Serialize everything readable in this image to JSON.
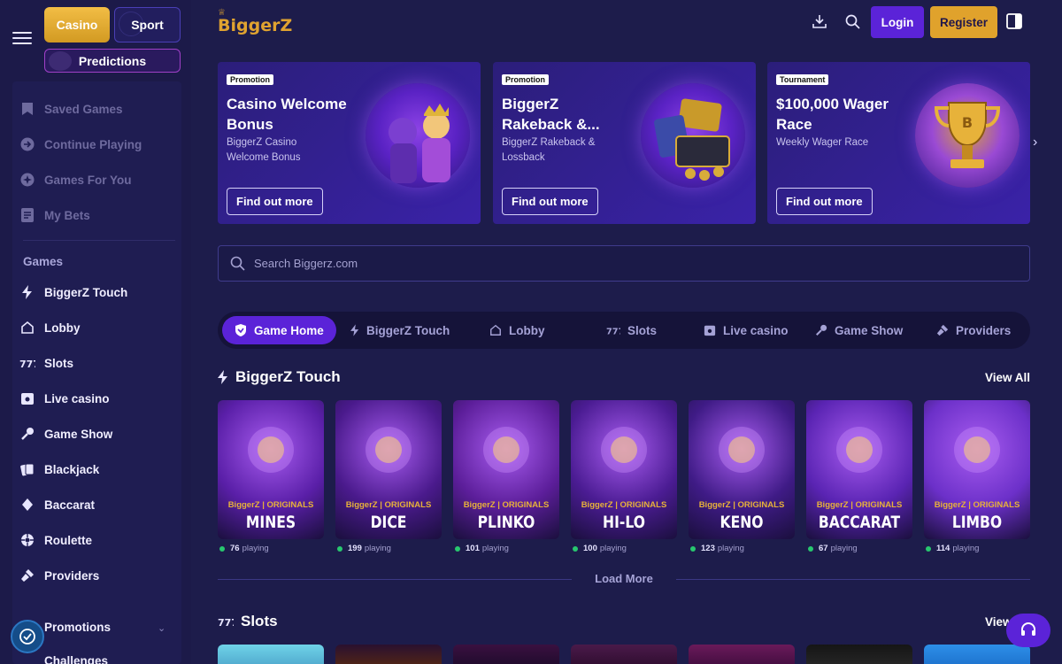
{
  "colors": {
    "accent_purple": "#5b23d8",
    "accent_gold": "#e0a22c",
    "bg": "#1d1c4b",
    "online": "#28c76f"
  },
  "sidebar": {
    "top_buttons": {
      "casino": "Casino",
      "sport": "Sport",
      "predictions": "Predictions"
    },
    "quick": [
      {
        "label": "Saved Games",
        "icon": "bookmark-icon"
      },
      {
        "label": "Continue Playing",
        "icon": "play-circle-icon"
      },
      {
        "label": "Games For You",
        "icon": "sparkle-icon"
      },
      {
        "label": "My Bets",
        "icon": "receipt-icon"
      }
    ],
    "games_header": "Games",
    "games": [
      {
        "label": "BiggerZ Touch",
        "icon": "lightning-icon"
      },
      {
        "label": "Lobby",
        "icon": "home-icon"
      },
      {
        "label": "Slots",
        "icon": "slots-icon"
      },
      {
        "label": "Live casino",
        "icon": "live-casino-icon"
      },
      {
        "label": "Game Show",
        "icon": "microphone-icon"
      },
      {
        "label": "Blackjack",
        "icon": "cards-icon"
      },
      {
        "label": "Baccarat",
        "icon": "baccarat-icon"
      },
      {
        "label": "Roulette",
        "icon": "roulette-icon"
      },
      {
        "label": "Providers",
        "icon": "providers-icon"
      }
    ],
    "promotions": "Promotions",
    "challenges": "Challenges"
  },
  "header": {
    "logo": "BiggerZ",
    "login": "Login",
    "register": "Register"
  },
  "promos": [
    {
      "tag": "Promotion",
      "title": "Casino Welcome Bonus",
      "subtitle": "BiggerZ Casino Welcome Bonus",
      "button": "Find out more"
    },
    {
      "tag": "Promotion",
      "title": "BiggerZ Rakeback &...",
      "subtitle": "BiggerZ Rakeback & Lossback",
      "button": "Find out more"
    },
    {
      "tag": "Tournament",
      "title": "$100,000 Wager Race",
      "subtitle": "Weekly Wager Race",
      "button": "Find out more"
    }
  ],
  "search": {
    "placeholder": "Search Biggerz.com"
  },
  "tabs": [
    {
      "label": "Game Home",
      "icon": "shield-icon"
    },
    {
      "label": "BiggerZ Touch",
      "icon": "lightning-icon"
    },
    {
      "label": "Lobby",
      "icon": "home-icon"
    },
    {
      "label": "Slots",
      "icon": "slots-icon"
    },
    {
      "label": "Live casino",
      "icon": "live-casino-icon"
    },
    {
      "label": "Game Show",
      "icon": "microphone-icon"
    },
    {
      "label": "Providers",
      "icon": "providers-icon"
    }
  ],
  "touch_section": {
    "title": "BiggerZ Touch",
    "view_all": "View All",
    "originals_label": "BiggerZ | ORIGINALS",
    "games": [
      {
        "name": "MINES",
        "playing": "76",
        "color": "#5a1fa8"
      },
      {
        "name": "DICE",
        "playing": "199",
        "color": "#4a1a8c"
      },
      {
        "name": "PLINKO",
        "playing": "101",
        "color": "#5c1e9a"
      },
      {
        "name": "HI-LO",
        "playing": "100",
        "color": "#4b1c93"
      },
      {
        "name": "KENO",
        "playing": "123",
        "color": "#3f1b86"
      },
      {
        "name": "BACCARAT",
        "playing": "67",
        "color": "#5a24b3"
      },
      {
        "name": "LIMBO",
        "playing": "114",
        "color": "#6c30c9"
      }
    ],
    "playing_suffix": "playing",
    "load_more": "Load More"
  },
  "slots_section": {
    "title": "Slots",
    "view_all": "View"
  }
}
